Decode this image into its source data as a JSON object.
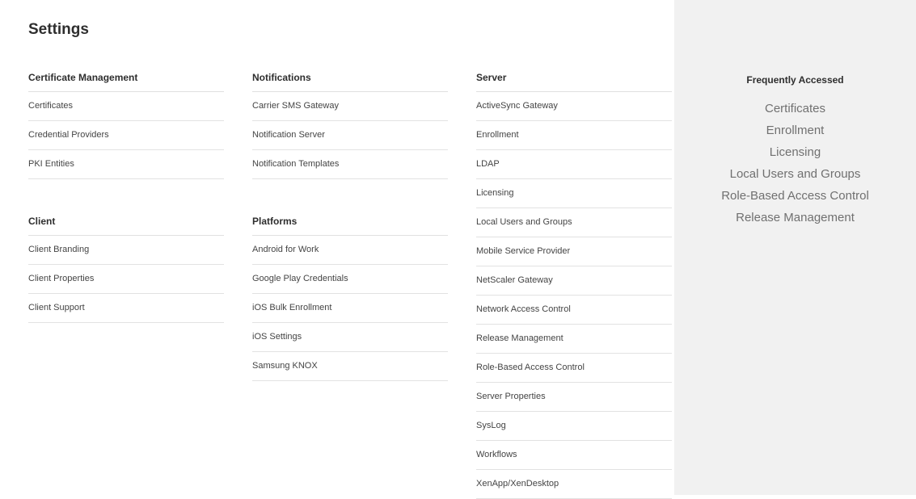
{
  "page": {
    "title": "Settings"
  },
  "groups": {
    "certificate_management": {
      "heading": "Certificate Management",
      "items": [
        "Certificates",
        "Credential Providers",
        "PKI Entities"
      ]
    },
    "client": {
      "heading": "Client",
      "items": [
        "Client Branding",
        "Client Properties",
        "Client Support"
      ]
    },
    "notifications": {
      "heading": "Notifications",
      "items": [
        "Carrier SMS Gateway",
        "Notification Server",
        "Notification Templates"
      ]
    },
    "platforms": {
      "heading": "Platforms",
      "items": [
        "Android for Work",
        "Google Play Credentials",
        "iOS Bulk Enrollment",
        "iOS Settings",
        "Samsung KNOX"
      ]
    },
    "server": {
      "heading": "Server",
      "items": [
        "ActiveSync Gateway",
        "Enrollment",
        "LDAP",
        "Licensing",
        "Local Users and Groups",
        "Mobile Service Provider",
        "NetScaler Gateway",
        "Network Access Control",
        "Release Management",
        "Role-Based Access Control",
        "Server Properties",
        "SysLog",
        "Workflows",
        "XenApp/XenDesktop"
      ]
    }
  },
  "frequently_accessed": {
    "heading": "Frequently Accessed",
    "items": [
      "Certificates",
      "Enrollment",
      "Licensing",
      "Local Users and Groups",
      "Role-Based Access Control",
      "Release Management"
    ]
  }
}
